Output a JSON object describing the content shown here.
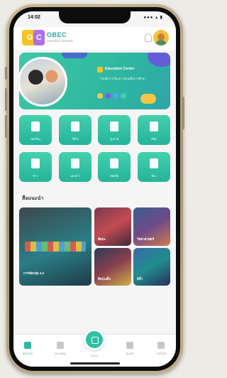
{
  "status": {
    "time": "14:02",
    "signal": "●●● ▴ ▮"
  },
  "app": {
    "logo_letters": [
      "G",
      "C"
    ],
    "brand": "OBEC",
    "brand_sub": "CONTENT CENTER"
  },
  "banner": {
    "title": "Education Center",
    "line": "รวมสื่อการเรียนการสอนเพื่อการศึกษา",
    "dot_colors": [
      "#f6c547",
      "#7b5ee6",
      "#5aa1ff",
      "#3fd0b0"
    ]
  },
  "grid": {
    "tiles": [
      {
        "label": "บทเรียน",
        "icon": "book-icon"
      },
      {
        "label": "วิดีโอ",
        "icon": "video-icon"
      },
      {
        "label": "รูปภาพ",
        "icon": "image-icon"
      },
      {
        "label": "เสียง",
        "icon": "music-icon"
      },
      {
        "label": "ข่าว",
        "icon": "news-icon"
      },
      {
        "label": "เอกสาร",
        "icon": "document-icon"
      },
      {
        "label": "หนังสือ",
        "icon": "ebook-icon"
      },
      {
        "label": "อื่นๆ",
        "icon": "more-icon"
      }
    ]
  },
  "section": {
    "title": "สื่อแนะนำ"
  },
  "cards": [
    {
      "title": "การจัดกลุ่ม 4.0",
      "sub": ""
    },
    {
      "title": "ศิลปะ",
      "sub": ""
    },
    {
      "title": "วิทยาศาสตร์",
      "sub": ""
    },
    {
      "title": "ศิลปะเด็ก",
      "sub": ""
    },
    {
      "title": "สีน้ำ",
      "sub": ""
    }
  ],
  "nav": {
    "items": [
      {
        "label": "หน้าแรก",
        "icon": "home-icon"
      },
      {
        "label": "หมวดหมู่",
        "icon": "category-icon"
      },
      {
        "label": "สแกน",
        "icon": "scan-icon"
      },
      {
        "label": "ชุมชน",
        "icon": "community-icon"
      },
      {
        "label": "โปรไฟล์",
        "icon": "profile-icon"
      }
    ]
  },
  "colors": {
    "accent": "#2fb9a0",
    "banner_blob": "#6c4fe0",
    "yellow": "#f7c325"
  }
}
